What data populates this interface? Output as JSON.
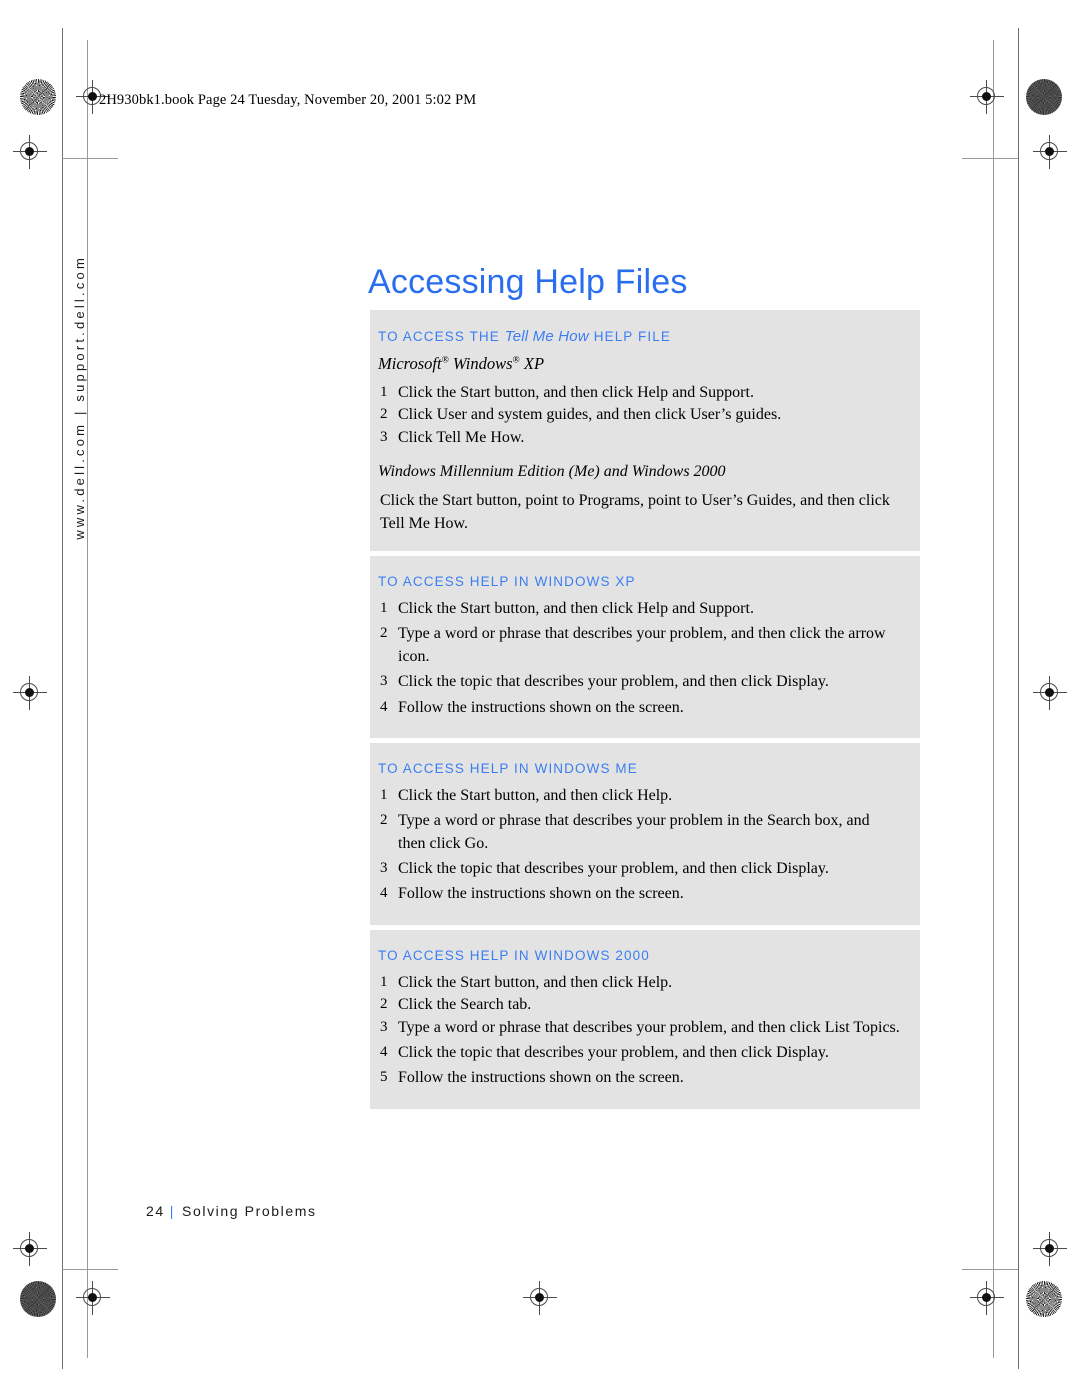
{
  "print_header": "2H930bk1.book  Page 24  Tuesday, November 20, 2001  5:02 PM",
  "side_rule_text": "www.dell.com | support.dell.com",
  "title": "Accessing Help Files",
  "colors": {
    "heading_blue": "#3b7ef2",
    "title_blue": "#2a6ef0",
    "panel_gray": "#e3e3e3",
    "page_white": "#ffffff"
  },
  "sections": [
    {
      "heading_pre": "To access the",
      "heading_product": "Tell Me How",
      "heading_post": "help file",
      "os_line_parts": {
        "a": "Microsoft",
        "reg1": "®",
        "b": "Windows",
        "reg2": "®",
        "c": "XP"
      },
      "steps": [
        {
          "n": "1",
          "text": "Click the Start button, and then click Help and Support."
        },
        {
          "n": "2",
          "text": "Click User and system guides, and then click User’s guides."
        },
        {
          "n": "3",
          "text": "Click Tell Me How."
        }
      ],
      "sub_heading": "Windows Millennium Edition (Me) and Windows 2000",
      "paragraph": "Click the Start button, point to Programs, point to User’s Guides, and then click Tell Me How."
    },
    {
      "heading_pre": "To access help in",
      "heading_product": "",
      "heading_post": "Windows XP",
      "steps": [
        {
          "n": "1",
          "text": "Click the Start button, and then click Help and Support."
        },
        {
          "n": "2",
          "text": "Type a word or phrase that describes your problem, and then click the arrow icon."
        },
        {
          "n": "3",
          "text": "Click the topic that describes your problem, and then click Display."
        },
        {
          "n": "4",
          "text": "Follow the instructions shown on the screen."
        }
      ]
    },
    {
      "heading_pre": "To access help in",
      "heading_product": "",
      "heading_post": "Windows Me",
      "steps": [
        {
          "n": "1",
          "text": "Click the Start button, and then click Help."
        },
        {
          "n": "2",
          "text": "Type a word or phrase that describes your problem in the Search box, and then click Go."
        },
        {
          "n": "3",
          "text": "Click the topic that describes your problem, and then click Display."
        },
        {
          "n": "4",
          "text": "Follow the instructions shown on the screen."
        }
      ]
    },
    {
      "heading_pre": "To access help in",
      "heading_product": "",
      "heading_post": "Windows 2000",
      "steps": [
        {
          "n": "1",
          "text": "Click the Start button, and then click Help."
        },
        {
          "n": "2",
          "text": "Click the Search tab."
        },
        {
          "n": "3",
          "text": "Type a word or phrase that describes your problem, and then click List Topics."
        },
        {
          "n": "4",
          "text": "Click the topic that describes your problem, and then click Display."
        },
        {
          "n": "5",
          "text": "Follow the instructions shown on the screen."
        }
      ]
    }
  ],
  "footer": {
    "page_number": "24",
    "separator": "|",
    "chapter": "Solving Problems"
  }
}
